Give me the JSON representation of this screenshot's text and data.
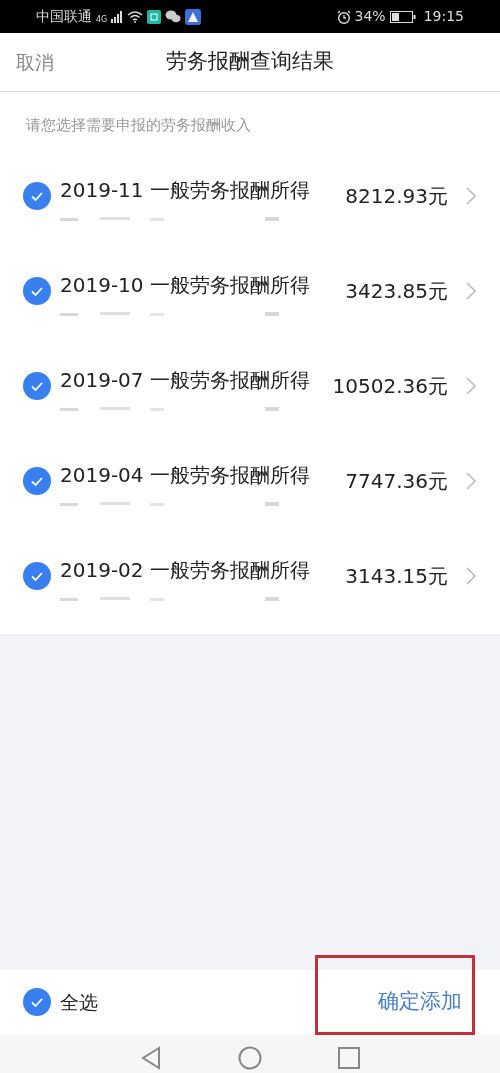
{
  "status_bar": {
    "carrier": "中国联通",
    "network": "4G",
    "battery": "34%",
    "time": "19:15"
  },
  "header": {
    "cancel": "取消",
    "title": "劳务报酬查询结果"
  },
  "hint": "请您选择需要申报的劳务报酬收入",
  "items": [
    {
      "title": "2019-11 一般劳务报酬所得",
      "amount": "8212.93元",
      "checked": true
    },
    {
      "title": "2019-10 一般劳务报酬所得",
      "amount": "3423.85元",
      "checked": true
    },
    {
      "title": "2019-07 一般劳务报酬所得",
      "amount": "10502.36元",
      "checked": true
    },
    {
      "title": "2019-04 一般劳务报酬所得",
      "amount": "7747.36元",
      "checked": true
    },
    {
      "title": "2019-02 一般劳务报酬所得",
      "amount": "3143.15元",
      "checked": true
    }
  ],
  "footer": {
    "select_all": {
      "label": "全选",
      "checked": true
    },
    "confirm": "确定添加",
    "highlighted": true
  }
}
